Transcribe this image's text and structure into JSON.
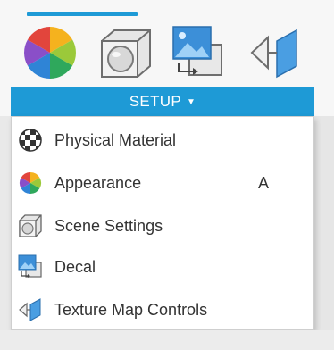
{
  "toolbar": {
    "tool_icons": [
      "appearance-icon",
      "scene-settings-icon",
      "decal-icon",
      "texture-map-icon"
    ],
    "accent_color": "#1e9ad6"
  },
  "setup_dropdown": {
    "label": "SETUP",
    "caret": "▼"
  },
  "menu": {
    "items": [
      {
        "label": "Physical Material",
        "icon": "physical-material-icon",
        "shortcut": ""
      },
      {
        "label": "Appearance",
        "icon": "appearance-icon",
        "shortcut": "A"
      },
      {
        "label": "Scene Settings",
        "icon": "scene-settings-icon",
        "shortcut": ""
      },
      {
        "label": "Decal",
        "icon": "decal-icon",
        "shortcut": ""
      },
      {
        "label": "Texture Map Controls",
        "icon": "texture-map-controls-icon",
        "shortcut": ""
      }
    ]
  }
}
